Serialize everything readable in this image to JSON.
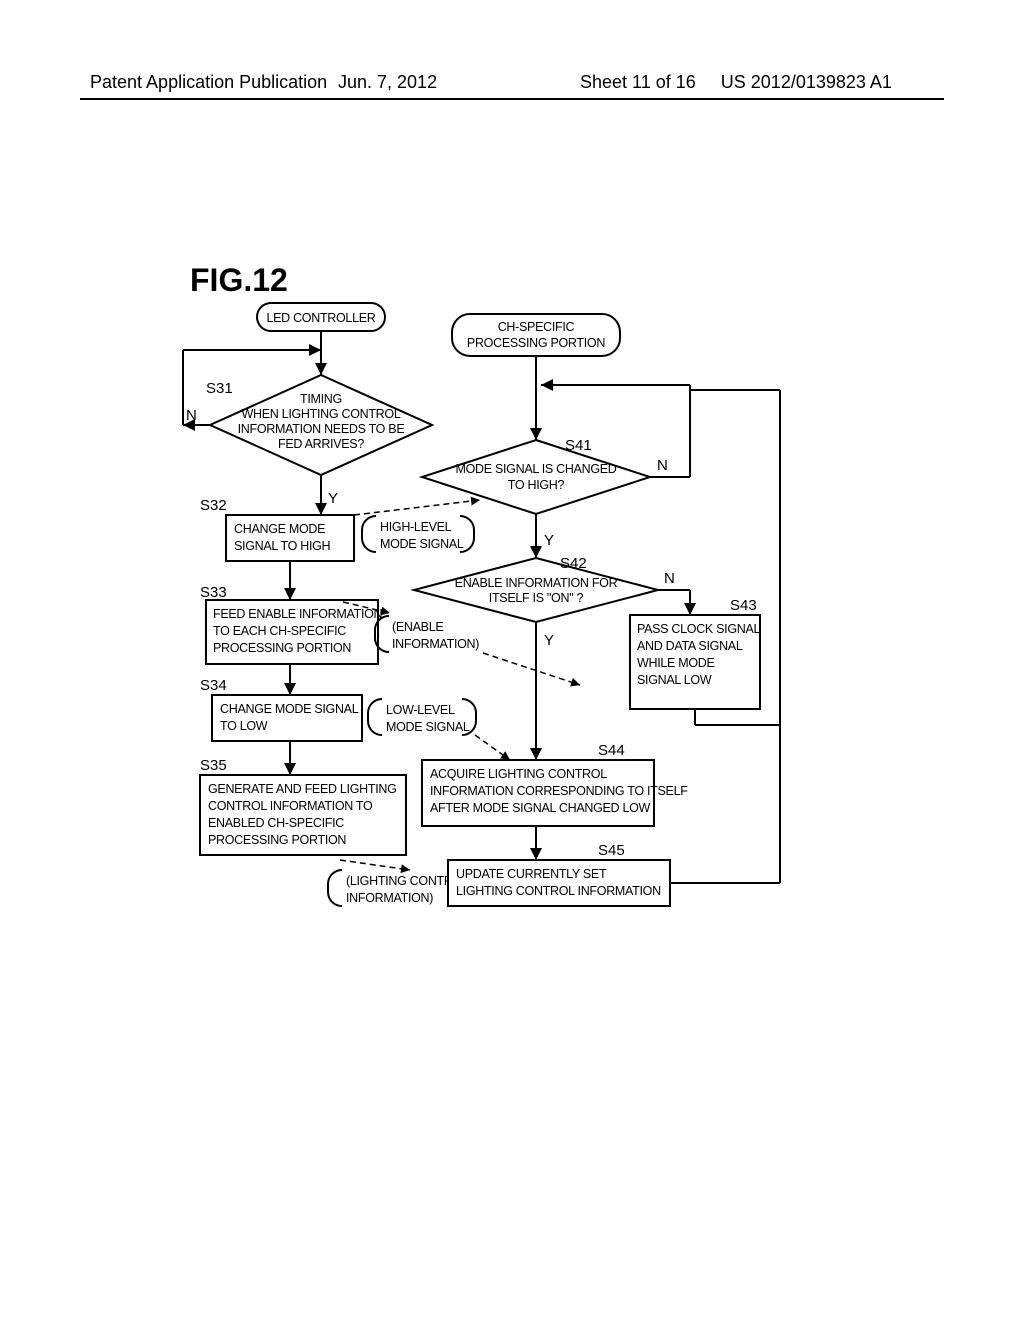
{
  "header": {
    "left": "Patent Application Publication",
    "center": "Jun. 7, 2012",
    "right_sheet": "Sheet 11 of 16",
    "right_num": "US 2012/0139823 A1"
  },
  "fig_label": "FIG.12",
  "left": {
    "start": "LED CONTROLLER",
    "s31_num": "S31",
    "s31": "TIMING WHEN LIGHTING CONTROL INFORMATION NEEDS TO BE FED ARRIVES?",
    "s32_num": "S32",
    "s32": "CHANGE MODE SIGNAL TO HIGH",
    "s33_num": "S33",
    "s33": "FEED ENABLE INFORMATION TO EACH CH-SPECIFIC PROCESSING PORTION",
    "s34_num": "S34",
    "s34": "CHANGE MODE SIGNAL TO LOW",
    "s35_num": "S35",
    "s35": "GENERATE AND FEED LIGHTING CONTROL INFORMATION TO ENABLED CH-SPECIFIC PROCESSING PORTION",
    "sig1": "HIGH-LEVEL MODE SIGNAL",
    "sig2": "(ENABLE INFORMATION)",
    "sig3": "LOW-LEVEL MODE SIGNAL",
    "sig4": "(LIGHTING CONTROL INFORMATION)"
  },
  "right": {
    "start": "CH-SPECIFIC PROCESSING PORTION",
    "s41_num": "S41",
    "s41": "MODE SIGNAL IS CHANGED TO HIGH?",
    "s42_num": "S42",
    "s42": "ENABLE INFORMATION FOR ITSELF IS \"ON\" ?",
    "s43_num": "S43",
    "s43": "PASS CLOCK SIGNAL AND DATA SIGNAL WHILE MODE SIGNAL LOW",
    "s44_num": "S44",
    "s44": "ACQUIRE LIGHTING CONTROL INFORMATION CORRESPONDING TO ITSELF AFTER MODE SIGNAL CHANGED LOW",
    "s45_num": "S45",
    "s45": "UPDATE CURRENTLY SET LIGHTING CONTROL INFORMATION"
  },
  "yn": {
    "y": "Y",
    "n": "N"
  }
}
